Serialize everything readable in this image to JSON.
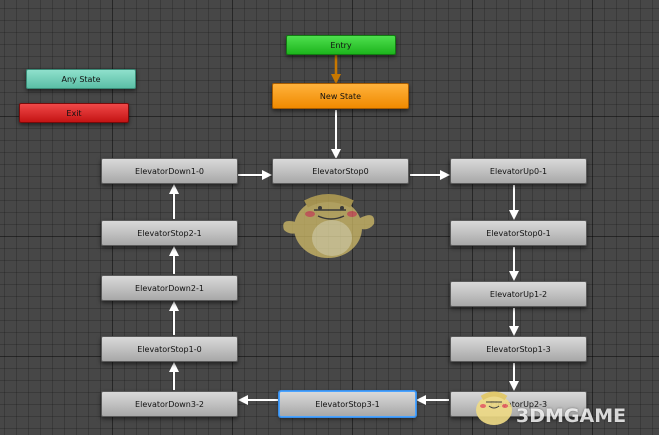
{
  "nodes": {
    "entry": "Entry",
    "new_state": "New State",
    "any_state": "Any State",
    "exit": "Exit",
    "down1_0": "ElevatorDown1-0",
    "stop0": "ElevatorStop0",
    "up0_1": "ElevatorUp0-1",
    "stop2_1": "ElevatorStop2-1",
    "stop0_1": "ElevatorStop0-1",
    "down2_1": "ElevatorDown2-1",
    "up1_2": "ElevatorUp1-2",
    "stop1_0": "ElevatorStop1-0",
    "stop1_3": "ElevatorStop1-3",
    "down3_2": "ElevatorDown3-2",
    "stop3_1": "ElevatorStop3-1",
    "up2_3": "ElevatorUp2-3"
  },
  "colors": {
    "entry": "#22c322",
    "default_state": "#f59400",
    "any_state": "#6fcfb8",
    "exit": "#dc1e1e",
    "transition": "#ffffff",
    "entry_transition": "#c87800",
    "selected_outline": "#3b8fe8"
  },
  "watermark": {
    "text": "3DMGAME"
  }
}
